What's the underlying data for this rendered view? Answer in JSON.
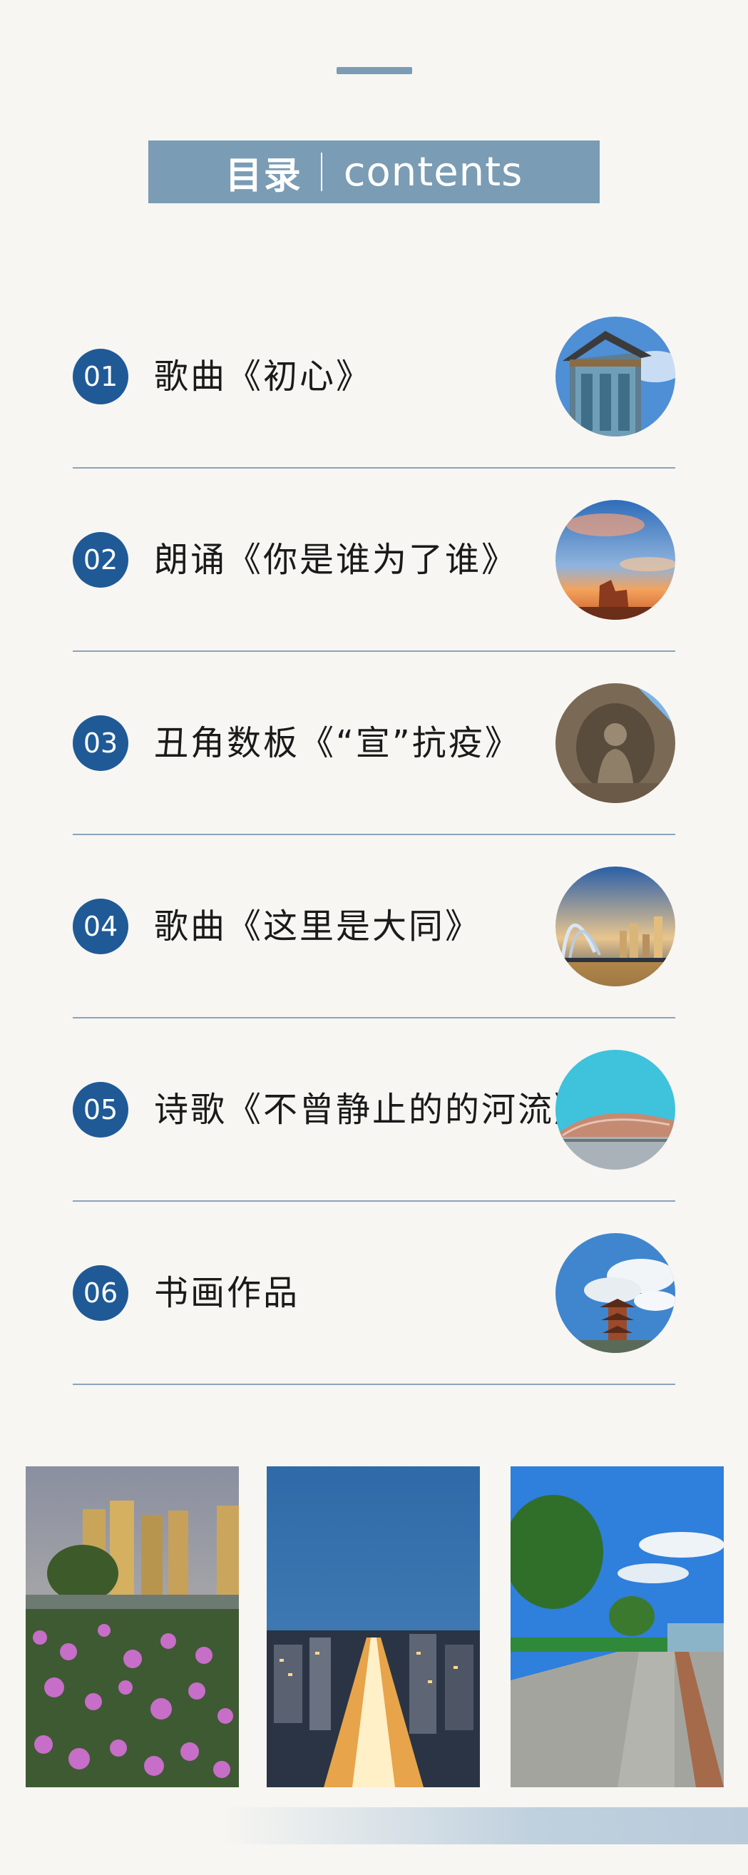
{
  "header": {
    "title_cn": "目录",
    "title_en": "contents"
  },
  "items": [
    {
      "num": "01",
      "title": "歌曲《初心》",
      "icon": "ornate-gate-tower"
    },
    {
      "num": "02",
      "title": "朗诵《你是谁为了谁》",
      "icon": "sunset-rock-formation"
    },
    {
      "num": "03",
      "title": "丑角数板《“宣”抗疫》",
      "icon": "cave-buddha-statue"
    },
    {
      "num": "04",
      "title": "歌曲《这里是大同》",
      "icon": "city-bridge-night"
    },
    {
      "num": "05",
      "title": "诗歌《不曾静止的的河流》",
      "icon": "modern-museum-building"
    },
    {
      "num": "06",
      "title": "书画作品",
      "icon": "pagoda-clouds"
    }
  ],
  "photos": [
    "flowers-high-rise",
    "city-night-aerial",
    "riverside-walkway"
  ],
  "colors": {
    "background": "#f7f6f2",
    "accent": "#7a9cb4",
    "number_badge": "#1f5a96",
    "divider": "#8aa4bb"
  }
}
